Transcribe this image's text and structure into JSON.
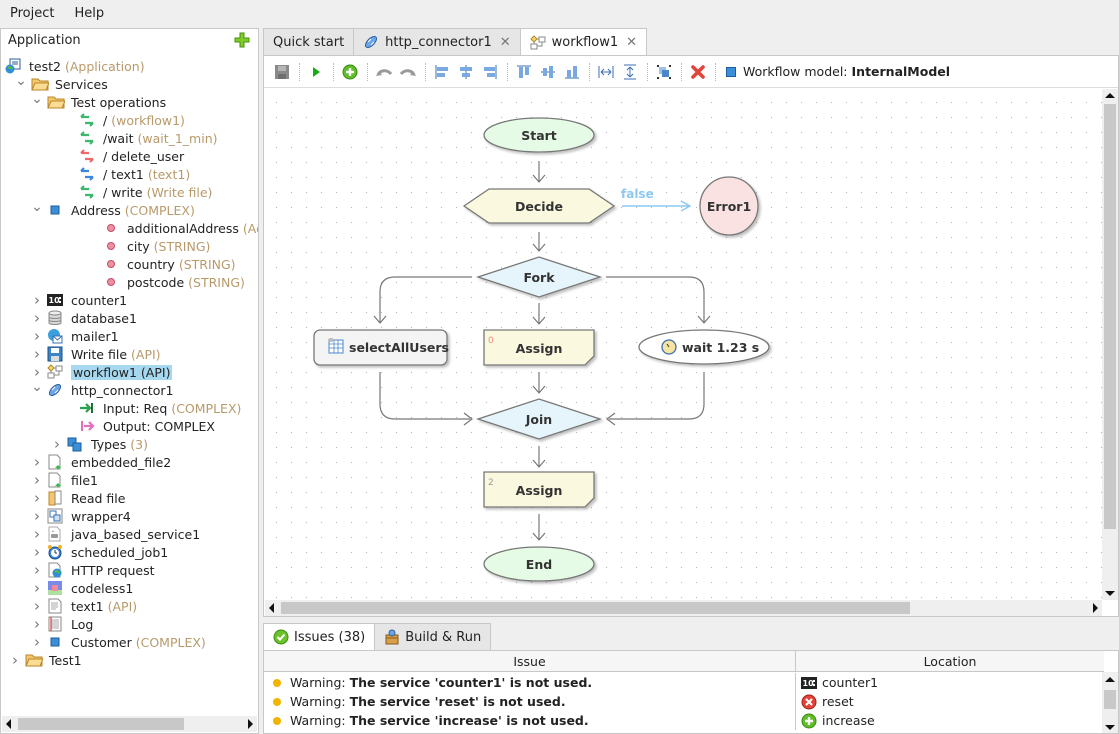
{
  "menu": [
    "Project",
    "Help"
  ],
  "left_panel": {
    "title": "Application",
    "add_icon": "plus-icon",
    "tree": [
      {
        "label": "test2",
        "sub": "(Application)",
        "icon": "application-icon",
        "level": 0,
        "toggle": ""
      },
      {
        "label": "Services",
        "sub": "",
        "icon": "folder-icon",
        "level": 1,
        "toggle": "expanded"
      },
      {
        "label": "Test operations",
        "sub": "",
        "icon": "folder-icon",
        "level": 2,
        "toggle": "expanded"
      },
      {
        "label": "/",
        "sub": "(workflow1)",
        "icon": "operation-green-icon",
        "level": 3,
        "toggle": ""
      },
      {
        "label": "/wait",
        "sub": "(wait_1_min)",
        "icon": "operation-green-icon",
        "level": 3,
        "toggle": ""
      },
      {
        "label": "/ delete_user",
        "sub": "",
        "icon": "operation-red-icon",
        "level": 3,
        "toggle": ""
      },
      {
        "label": "/ text1",
        "sub": "(text1)",
        "icon": "operation-blue-icon",
        "level": 3,
        "toggle": ""
      },
      {
        "label": "/ write",
        "sub": "(Write file)",
        "icon": "operation-green-icon",
        "level": 3,
        "toggle": ""
      },
      {
        "label": "Address",
        "sub": "(COMPLEX)",
        "icon": "complex-type-icon",
        "level": 2,
        "toggle": "expanded"
      },
      {
        "label": "additionalAddress",
        "sub": "(Address)",
        "icon": "field-icon",
        "level": 4,
        "toggle": ""
      },
      {
        "label": "city",
        "sub": "(STRING)",
        "icon": "field-icon",
        "level": 4,
        "toggle": ""
      },
      {
        "label": "country",
        "sub": "(STRING)",
        "icon": "field-icon",
        "level": 4,
        "toggle": ""
      },
      {
        "label": "postcode",
        "sub": "(STRING)",
        "icon": "field-icon",
        "level": 4,
        "toggle": ""
      },
      {
        "label": "counter1",
        "sub": "",
        "icon": "counter-icon",
        "level": 1.5,
        "toggle": "collapsed"
      },
      {
        "label": "database1",
        "sub": "",
        "icon": "database-icon",
        "level": 1.5,
        "toggle": "collapsed"
      },
      {
        "label": "mailer1",
        "sub": "",
        "icon": "mailer-icon",
        "level": 1.5,
        "toggle": "collapsed"
      },
      {
        "label": "Write file",
        "sub": "(API)",
        "icon": "floppy-icon",
        "level": 1.5,
        "toggle": "collapsed"
      },
      {
        "label": "workflow1 (API)",
        "sub": "",
        "icon": "workflow-icon",
        "level": 1.5,
        "toggle": "collapsed",
        "selected": true
      },
      {
        "label": "http_connector1",
        "sub": "",
        "icon": "connector-icon",
        "level": 1.5,
        "toggle": "expanded"
      },
      {
        "label": "Input: Req",
        "sub": "(COMPLEX)",
        "icon": "input-arrow-icon",
        "level": 3,
        "toggle": ""
      },
      {
        "label": "Output: COMPLEX",
        "sub": "",
        "icon": "output-arrow-icon",
        "level": 3,
        "toggle": ""
      },
      {
        "label": "Types",
        "sub": "(3)",
        "icon": "types-icon",
        "level": 2.5,
        "toggle": "collapsed"
      },
      {
        "label": "embedded_file2",
        "sub": "",
        "icon": "file-upload-icon",
        "level": 1.5,
        "toggle": "collapsed"
      },
      {
        "label": "file1",
        "sub": "",
        "icon": "file-upload-icon",
        "level": 1.5,
        "toggle": "collapsed"
      },
      {
        "label": "Read file",
        "sub": "",
        "icon": "read-file-icon",
        "level": 1.5,
        "toggle": "collapsed"
      },
      {
        "label": "wrapper4",
        "sub": "",
        "icon": "wrapper-icon",
        "level": 1.5,
        "toggle": "collapsed"
      },
      {
        "label": "java_based_service1",
        "sub": "",
        "icon": "java-service-icon",
        "level": 1.5,
        "toggle": "collapsed"
      },
      {
        "label": "scheduled_job1",
        "sub": "",
        "icon": "alarm-clock-icon",
        "level": 1.5,
        "toggle": "collapsed"
      },
      {
        "label": "HTTP request",
        "sub": "",
        "icon": "http-request-icon",
        "level": 1.5,
        "toggle": "collapsed"
      },
      {
        "label": "codeless1",
        "sub": "",
        "icon": "codeless-icon",
        "level": 1.5,
        "toggle": "collapsed"
      },
      {
        "label": "text1",
        "sub": "(API)",
        "icon": "text-file-icon",
        "level": 1.5,
        "toggle": "collapsed"
      },
      {
        "label": "Log",
        "sub": "",
        "icon": "log-icon",
        "level": 1.5,
        "toggle": "collapsed"
      },
      {
        "label": "Customer",
        "sub": "(COMPLEX)",
        "icon": "complex-type-icon",
        "level": 1.5,
        "toggle": "collapsed"
      },
      {
        "label": "Test1",
        "sub": "",
        "icon": "folder-icon",
        "level": 0.5,
        "toggle": "collapsed"
      }
    ]
  },
  "editor_tabs": [
    {
      "label": "Quick start",
      "icon": "",
      "closable": false,
      "active": false
    },
    {
      "label": "http_connector1",
      "icon": "connector-icon",
      "closable": true,
      "active": false
    },
    {
      "label": "workflow1",
      "icon": "workflow-icon",
      "closable": true,
      "active": true
    }
  ],
  "toolbar": {
    "buttons": [
      "save-icon",
      "run-icon",
      "add-icon",
      "undo-icon",
      "redo-icon",
      "align-left-icon",
      "align-center-icon",
      "align-right-icon",
      "align-top-icon",
      "align-middle-icon",
      "align-bottom-icon",
      "distribute-horizontal-icon",
      "distribute-vertical-icon",
      "select-all-icon",
      "delete-icon"
    ],
    "model_label": "Workflow model:",
    "model_value": "InternalModel"
  },
  "workflow": {
    "nodes": [
      {
        "id": "start",
        "label": "Start",
        "shape": "ellipse",
        "fill": "#e6fbe6"
      },
      {
        "id": "decide",
        "label": "Decide",
        "shape": "hexagon",
        "fill": "#fbf8e0"
      },
      {
        "id": "error1",
        "label": "Error1",
        "shape": "circle",
        "fill": "#fbe2e2"
      },
      {
        "id": "fork",
        "label": "Fork",
        "shape": "diamond",
        "fill": "#e6f4fb"
      },
      {
        "id": "select",
        "label": "selectAllUsers",
        "shape": "rounded-rect",
        "fill": "#f4f4f4"
      },
      {
        "id": "assign0",
        "label": "Assign",
        "index": "0",
        "shape": "note",
        "fill": "#fbf8e0"
      },
      {
        "id": "wait",
        "label": "wait 1.23 s",
        "shape": "ellipse",
        "fill": "#ffffff"
      },
      {
        "id": "join",
        "label": "Join",
        "shape": "diamond",
        "fill": "#e6f4fb"
      },
      {
        "id": "assign2",
        "label": "Assign",
        "index": "2",
        "shape": "note",
        "fill": "#fbf8e0"
      },
      {
        "id": "end",
        "label": "End",
        "shape": "ellipse",
        "fill": "#e6fbe6"
      }
    ],
    "edge_label_false": "false"
  },
  "bottom_tabs": [
    {
      "label": "Issues (38)",
      "icon": "check-circle-icon",
      "active": true
    },
    {
      "label": "Build & Run",
      "icon": "build-icon",
      "active": false
    }
  ],
  "issues": {
    "columns": [
      "Issue",
      "Location"
    ],
    "rows": [
      {
        "severity": "Warning:",
        "message": "The service 'counter1' is not used.",
        "location": "counter1",
        "location_icon": "counter-icon"
      },
      {
        "severity": "Warning:",
        "message": "The service 'reset' is not used.",
        "location": "reset",
        "location_icon": "error-circle-icon"
      },
      {
        "severity": "Warning:",
        "message": "The service 'increase' is not used.",
        "location": "increase",
        "location_icon": "add-circle-icon"
      }
    ]
  },
  "colors": {
    "selection": "#a6d8f0",
    "sub_label": "#b89a6a",
    "false_edge": "#8cc8f2",
    "warning_dot": "#f2b400"
  }
}
